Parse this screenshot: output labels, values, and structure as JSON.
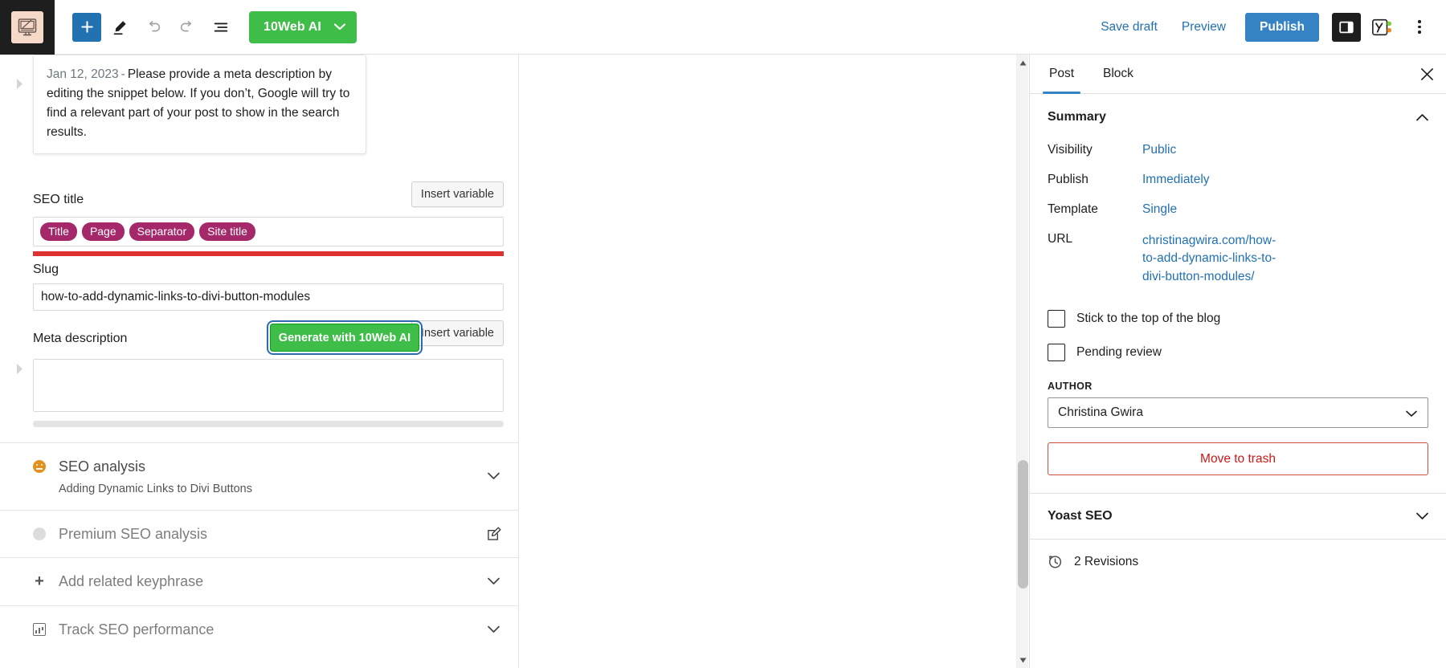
{
  "toolbar": {
    "logo_icon": "wordpress-site-icon",
    "add_block_label": "+",
    "tools_icon": "pencil-tools-icon",
    "undo_icon": "undo-icon",
    "redo_icon": "redo-icon",
    "list_view_icon": "document-overview-icon",
    "tenweb_ai_label": "10Web AI",
    "tenweb_chevron_icon": "chevron-down-icon",
    "save_draft_label": "Save draft",
    "preview_label": "Preview",
    "publish_label": "Publish",
    "settings_icon": "sidebar-toggle-icon",
    "yoast_icon": "yoast-seo-icon",
    "options_icon": "kebab-menu-icon",
    "accent_blue": "#3582c4",
    "accent_green": "#3fbd49"
  },
  "notice": {
    "date": "Jan 12, 2023",
    "separator": "-",
    "text": "Please provide a meta description by editing the snippet below. If you don’t, Google will try to find a relevant part of your post to show in the search results."
  },
  "seo_editor": {
    "seo_title_label": "SEO title",
    "insert_variable_label": "Insert variable",
    "title_variables": [
      "Title",
      "Page",
      "Separator",
      "Site title"
    ],
    "pill_color": "#a4286a",
    "progress_color": "#dd3232",
    "slug_label": "Slug",
    "slug_value": "how-to-add-dynamic-links-to-divi-button-modules",
    "meta_description_label": "Meta description",
    "generate_button_label": "Generate with 10Web AI",
    "meta_insert_variable_label": "Insert variable",
    "meta_description_value": ""
  },
  "accordion": [
    {
      "title": "SEO analysis",
      "subtitle": "Adding Dynamic Links to Divi Buttons",
      "bullet": "ok",
      "bullet_color": "#e2911f",
      "icon": "smiley-face-icon",
      "control": "chevron-down-icon"
    },
    {
      "title": "Premium SEO analysis",
      "subtitle": "",
      "bullet": "grey",
      "bullet_color": "#dcdcdc",
      "icon": "grey-circle-icon",
      "control": "edit-square-icon"
    },
    {
      "title": "Add related keyphrase",
      "subtitle": "",
      "bullet": "plus",
      "icon": "plus-icon",
      "control": "chevron-down-icon"
    },
    {
      "title": "Track SEO performance",
      "subtitle": "",
      "bullet": "chart",
      "icon": "bar-chart-icon",
      "control": "chevron-down-icon"
    }
  ],
  "sidebar": {
    "tabs": [
      {
        "label": "Post",
        "active": true
      },
      {
        "label": "Block",
        "active": false
      }
    ],
    "close_icon": "close-icon",
    "summary": {
      "title": "Summary",
      "collapse_icon": "chevron-up-icon",
      "rows": [
        {
          "label": "Visibility",
          "value": "Public"
        },
        {
          "label": "Publish",
          "value": "Immediately"
        },
        {
          "label": "Template",
          "value": "Single"
        },
        {
          "label": "URL",
          "value": "christinagwira.com/how-to-add-dynamic-links-to-divi-button-modules/"
        }
      ]
    },
    "checkboxes": [
      {
        "label": "Stick to the top of the blog",
        "checked": false
      },
      {
        "label": "Pending review",
        "checked": false
      }
    ],
    "author_label": "AUTHOR",
    "author_value": "Christina Gwira",
    "author_chevron_icon": "chevron-down-icon",
    "trash_label": "Move to trash",
    "trash_color": "#cc1818",
    "yoast_panel_label": "Yoast SEO",
    "yoast_panel_chevron": "chevron-down-icon",
    "revisions_label": "2 Revisions",
    "revisions_icon": "clock-history-icon"
  }
}
